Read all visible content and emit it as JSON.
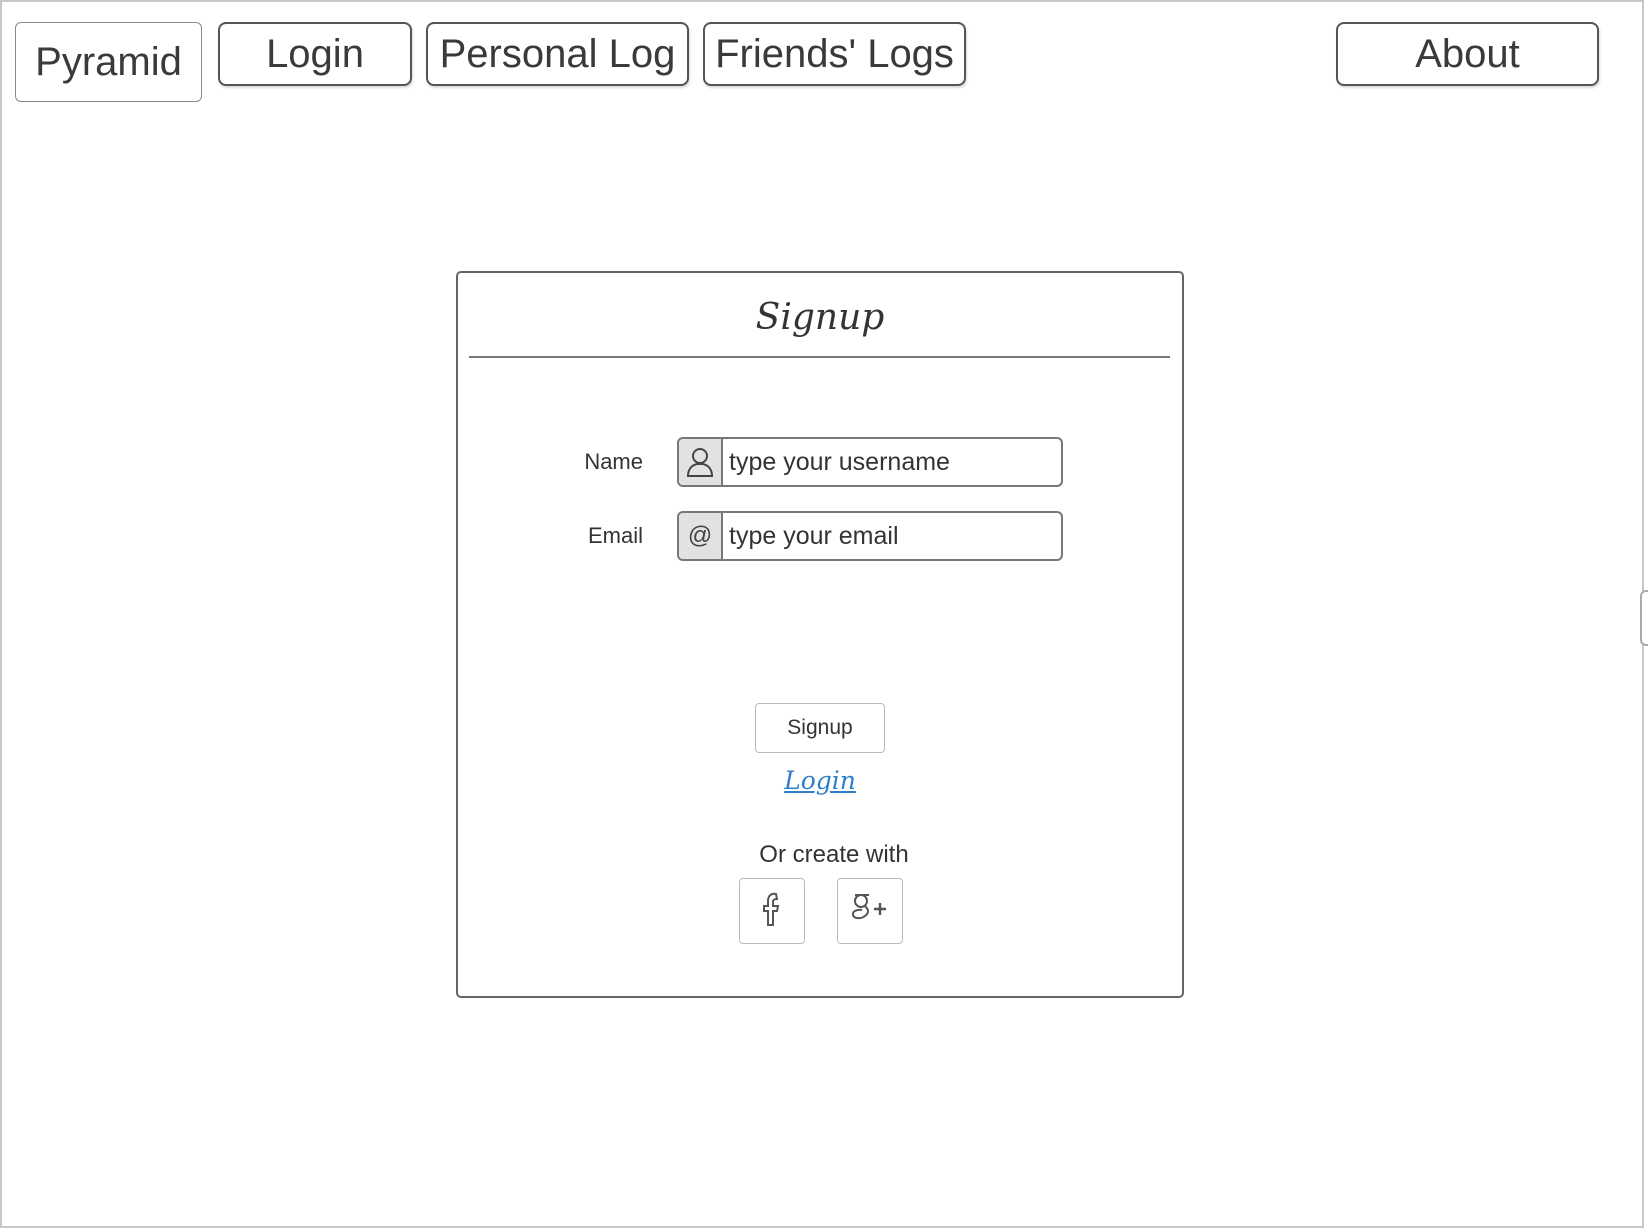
{
  "nav": {
    "brand": "Pyramid",
    "login": "Login",
    "personal_log": "Personal Log",
    "friends_logs": "Friends' Logs",
    "about": "About"
  },
  "signup_form": {
    "title": "Signup",
    "name_label": "Name",
    "name_placeholder": "type your username",
    "email_label": "Email",
    "email_placeholder": "type your email",
    "email_addon": "@",
    "submit_label": "Signup",
    "login_link": "Login",
    "create_with": "Or create with",
    "social": [
      {
        "icon": "facebook-icon",
        "glyph": "f"
      },
      {
        "icon": "google-plus-icon",
        "glyph": "g+"
      }
    ]
  },
  "colors": {
    "link": "#2f7fc9",
    "border": "#777777",
    "addon_bg": "#e2e2e2"
  }
}
